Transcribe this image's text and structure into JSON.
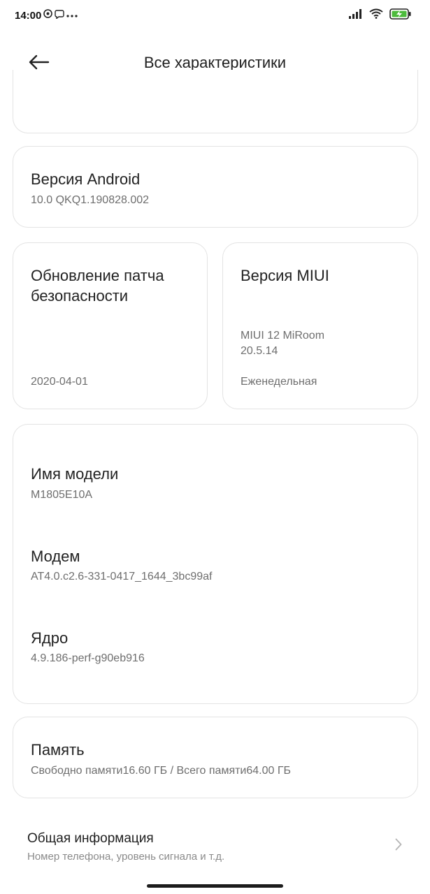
{
  "status_bar": {
    "time": "14:00",
    "left_icons": [
      "at-sign-icon",
      "viber-icon",
      "more-dots-icon"
    ],
    "right_icons": [
      "signal-icon",
      "wifi-icon",
      "battery-charging-icon"
    ],
    "battery_color": "#4cbb3c"
  },
  "header": {
    "title": "Все характеристики",
    "back_icon": "arrow-left-icon"
  },
  "cards": {
    "android": {
      "title": "Версия Android",
      "value": "10.0 QKQ1.190828.002"
    },
    "security_patch": {
      "title_line1": "Обновление патча",
      "title_line2": "безопасности",
      "value": "2020-04-01"
    },
    "miui": {
      "title": "Версия MIUI",
      "value_line1": "MIUI 12 MiRoom",
      "value_line2": "20.5.14",
      "channel": "Еженедельная"
    },
    "model": {
      "title": "Имя модели",
      "value": "M1805E10A"
    },
    "modem": {
      "title": "Модем",
      "value": "AT4.0.c2.6-331-0417_1644_3bc99af"
    },
    "kernel": {
      "title": "Ядро",
      "value": "4.9.186-perf-g90eb916"
    },
    "memory": {
      "title": "Память",
      "value": "Свободно памяти16.60 ГБ / Всего памяти64.00 ГБ"
    }
  },
  "general_info": {
    "title": "Общая информация",
    "subtitle": "Номер телефона, уровень сигнала и т.д.",
    "chevron_icon": "chevron-right-icon"
  }
}
